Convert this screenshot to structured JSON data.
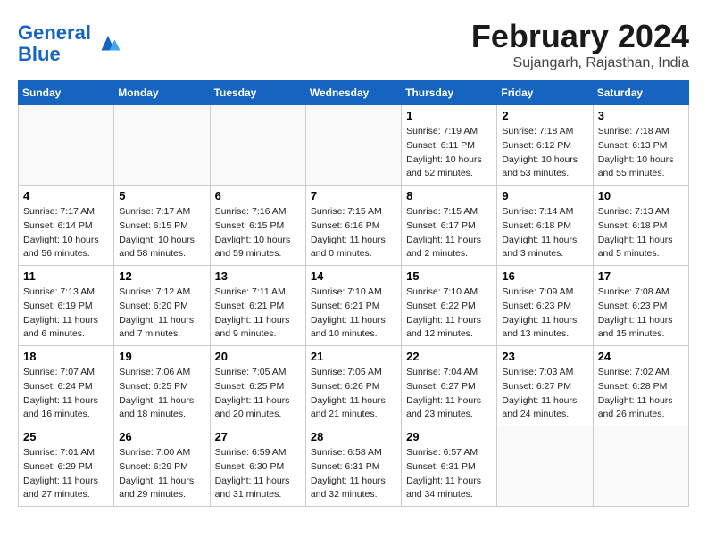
{
  "logo": {
    "line1": "General",
    "line2": "Blue"
  },
  "title": "February 2024",
  "subtitle": "Sujangarh, Rajasthan, India",
  "days_of_week": [
    "Sunday",
    "Monday",
    "Tuesday",
    "Wednesday",
    "Thursday",
    "Friday",
    "Saturday"
  ],
  "weeks": [
    [
      {
        "day": "",
        "info": ""
      },
      {
        "day": "",
        "info": ""
      },
      {
        "day": "",
        "info": ""
      },
      {
        "day": "",
        "info": ""
      },
      {
        "day": "1",
        "info": "Sunrise: 7:19 AM\nSunset: 6:11 PM\nDaylight: 10 hours\nand 52 minutes."
      },
      {
        "day": "2",
        "info": "Sunrise: 7:18 AM\nSunset: 6:12 PM\nDaylight: 10 hours\nand 53 minutes."
      },
      {
        "day": "3",
        "info": "Sunrise: 7:18 AM\nSunset: 6:13 PM\nDaylight: 10 hours\nand 55 minutes."
      }
    ],
    [
      {
        "day": "4",
        "info": "Sunrise: 7:17 AM\nSunset: 6:14 PM\nDaylight: 10 hours\nand 56 minutes."
      },
      {
        "day": "5",
        "info": "Sunrise: 7:17 AM\nSunset: 6:15 PM\nDaylight: 10 hours\nand 58 minutes."
      },
      {
        "day": "6",
        "info": "Sunrise: 7:16 AM\nSunset: 6:15 PM\nDaylight: 10 hours\nand 59 minutes."
      },
      {
        "day": "7",
        "info": "Sunrise: 7:15 AM\nSunset: 6:16 PM\nDaylight: 11 hours\nand 0 minutes."
      },
      {
        "day": "8",
        "info": "Sunrise: 7:15 AM\nSunset: 6:17 PM\nDaylight: 11 hours\nand 2 minutes."
      },
      {
        "day": "9",
        "info": "Sunrise: 7:14 AM\nSunset: 6:18 PM\nDaylight: 11 hours\nand 3 minutes."
      },
      {
        "day": "10",
        "info": "Sunrise: 7:13 AM\nSunset: 6:18 PM\nDaylight: 11 hours\nand 5 minutes."
      }
    ],
    [
      {
        "day": "11",
        "info": "Sunrise: 7:13 AM\nSunset: 6:19 PM\nDaylight: 11 hours\nand 6 minutes."
      },
      {
        "day": "12",
        "info": "Sunrise: 7:12 AM\nSunset: 6:20 PM\nDaylight: 11 hours\nand 7 minutes."
      },
      {
        "day": "13",
        "info": "Sunrise: 7:11 AM\nSunset: 6:21 PM\nDaylight: 11 hours\nand 9 minutes."
      },
      {
        "day": "14",
        "info": "Sunrise: 7:10 AM\nSunset: 6:21 PM\nDaylight: 11 hours\nand 10 minutes."
      },
      {
        "day": "15",
        "info": "Sunrise: 7:10 AM\nSunset: 6:22 PM\nDaylight: 11 hours\nand 12 minutes."
      },
      {
        "day": "16",
        "info": "Sunrise: 7:09 AM\nSunset: 6:23 PM\nDaylight: 11 hours\nand 13 minutes."
      },
      {
        "day": "17",
        "info": "Sunrise: 7:08 AM\nSunset: 6:23 PM\nDaylight: 11 hours\nand 15 minutes."
      }
    ],
    [
      {
        "day": "18",
        "info": "Sunrise: 7:07 AM\nSunset: 6:24 PM\nDaylight: 11 hours\nand 16 minutes."
      },
      {
        "day": "19",
        "info": "Sunrise: 7:06 AM\nSunset: 6:25 PM\nDaylight: 11 hours\nand 18 minutes."
      },
      {
        "day": "20",
        "info": "Sunrise: 7:05 AM\nSunset: 6:25 PM\nDaylight: 11 hours\nand 20 minutes."
      },
      {
        "day": "21",
        "info": "Sunrise: 7:05 AM\nSunset: 6:26 PM\nDaylight: 11 hours\nand 21 minutes."
      },
      {
        "day": "22",
        "info": "Sunrise: 7:04 AM\nSunset: 6:27 PM\nDaylight: 11 hours\nand 23 minutes."
      },
      {
        "day": "23",
        "info": "Sunrise: 7:03 AM\nSunset: 6:27 PM\nDaylight: 11 hours\nand 24 minutes."
      },
      {
        "day": "24",
        "info": "Sunrise: 7:02 AM\nSunset: 6:28 PM\nDaylight: 11 hours\nand 26 minutes."
      }
    ],
    [
      {
        "day": "25",
        "info": "Sunrise: 7:01 AM\nSunset: 6:29 PM\nDaylight: 11 hours\nand 27 minutes."
      },
      {
        "day": "26",
        "info": "Sunrise: 7:00 AM\nSunset: 6:29 PM\nDaylight: 11 hours\nand 29 minutes."
      },
      {
        "day": "27",
        "info": "Sunrise: 6:59 AM\nSunset: 6:30 PM\nDaylight: 11 hours\nand 31 minutes."
      },
      {
        "day": "28",
        "info": "Sunrise: 6:58 AM\nSunset: 6:31 PM\nDaylight: 11 hours\nand 32 minutes."
      },
      {
        "day": "29",
        "info": "Sunrise: 6:57 AM\nSunset: 6:31 PM\nDaylight: 11 hours\nand 34 minutes."
      },
      {
        "day": "",
        "info": ""
      },
      {
        "day": "",
        "info": ""
      }
    ]
  ]
}
